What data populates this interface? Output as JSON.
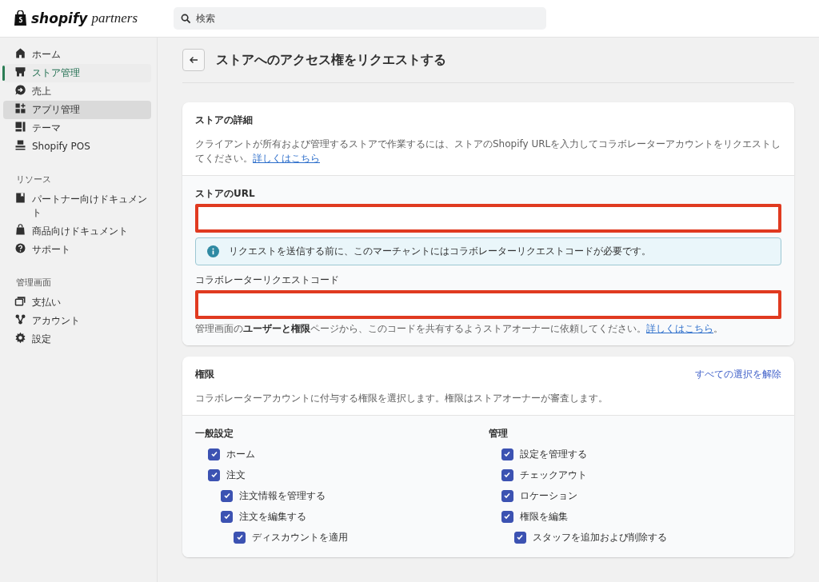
{
  "brand": {
    "name": "shopify",
    "suffix": "partners"
  },
  "search": {
    "placeholder": "検索"
  },
  "sidebar": {
    "sections": [
      {
        "items": [
          {
            "label": "ホーム",
            "selected": false,
            "hovered": false
          },
          {
            "label": "ストア管理",
            "selected": true,
            "hovered": false
          },
          {
            "label": "売上",
            "selected": false,
            "hovered": false
          },
          {
            "label": "アプリ管理",
            "selected": false,
            "hovered": true
          },
          {
            "label": "テーマ",
            "selected": false,
            "hovered": false
          },
          {
            "label": "Shopify POS",
            "selected": false,
            "hovered": false
          }
        ]
      },
      {
        "title": "リソース",
        "items": [
          {
            "label": "パートナー向けドキュメント",
            "selected": false,
            "hovered": false
          },
          {
            "label": "商品向けドキュメント",
            "selected": false,
            "hovered": false
          },
          {
            "label": "サポート",
            "selected": false,
            "hovered": false
          }
        ]
      },
      {
        "title": "管理画面",
        "items": [
          {
            "label": "支払い",
            "selected": false,
            "hovered": false
          },
          {
            "label": "アカウント",
            "selected": false,
            "hovered": false
          },
          {
            "label": "設定",
            "selected": false,
            "hovered": false
          }
        ]
      }
    ]
  },
  "page": {
    "title": "ストアへのアクセス権をリクエストする"
  },
  "store_details": {
    "title": "ストアの詳細",
    "description": "クライアントが所有および管理するストアで作業するには、ストアのShopify URLを入力してコラボレーターアカウントをリクエストしてください。",
    "link": "詳しくはこちら",
    "url_field": {
      "label": "ストアのURL",
      "highlighted": true
    },
    "notice": "リクエストを送信する前に、このマーチャントにはコラボレーターリクエストコードが必要です。",
    "code_field": {
      "label": "コラボレーターリクエストコード",
      "highlighted": true,
      "help": "管理画面の**ユーザーと権限**ページから、このコードを共有するようストアオーナーに依頼してください。",
      "help_link": "詳しくはこちら",
      "help_end": "。"
    }
  },
  "permissions": {
    "title": "権限",
    "action": "すべての選択を解除",
    "description": "コラボレーターアカウントに付与する権限を選択します。権限はストアオーナーが審査します。",
    "groups": [
      {
        "title": "一般設定",
        "items": [
          {
            "label": "ホーム",
            "checked": true
          },
          {
            "label": "注文",
            "checked": true,
            "children": [
              {
                "label": "注文情報を管理する",
                "checked": true
              },
              {
                "label": "注文を編集する",
                "checked": true,
                "children": [
                  {
                    "label": "ディスカウントを適用",
                    "checked": true
                  }
                ]
              }
            ]
          }
        ]
      },
      {
        "title": "管理",
        "items": [
          {
            "label": "設定を管理する",
            "checked": true
          },
          {
            "label": "チェックアウト",
            "checked": true
          },
          {
            "label": "ロケーション",
            "checked": true
          },
          {
            "label": "権限を編集",
            "checked": true,
            "children": [
              {
                "label": "スタッフを追加および削除する",
                "checked": true
              }
            ]
          }
        ]
      }
    ]
  }
}
